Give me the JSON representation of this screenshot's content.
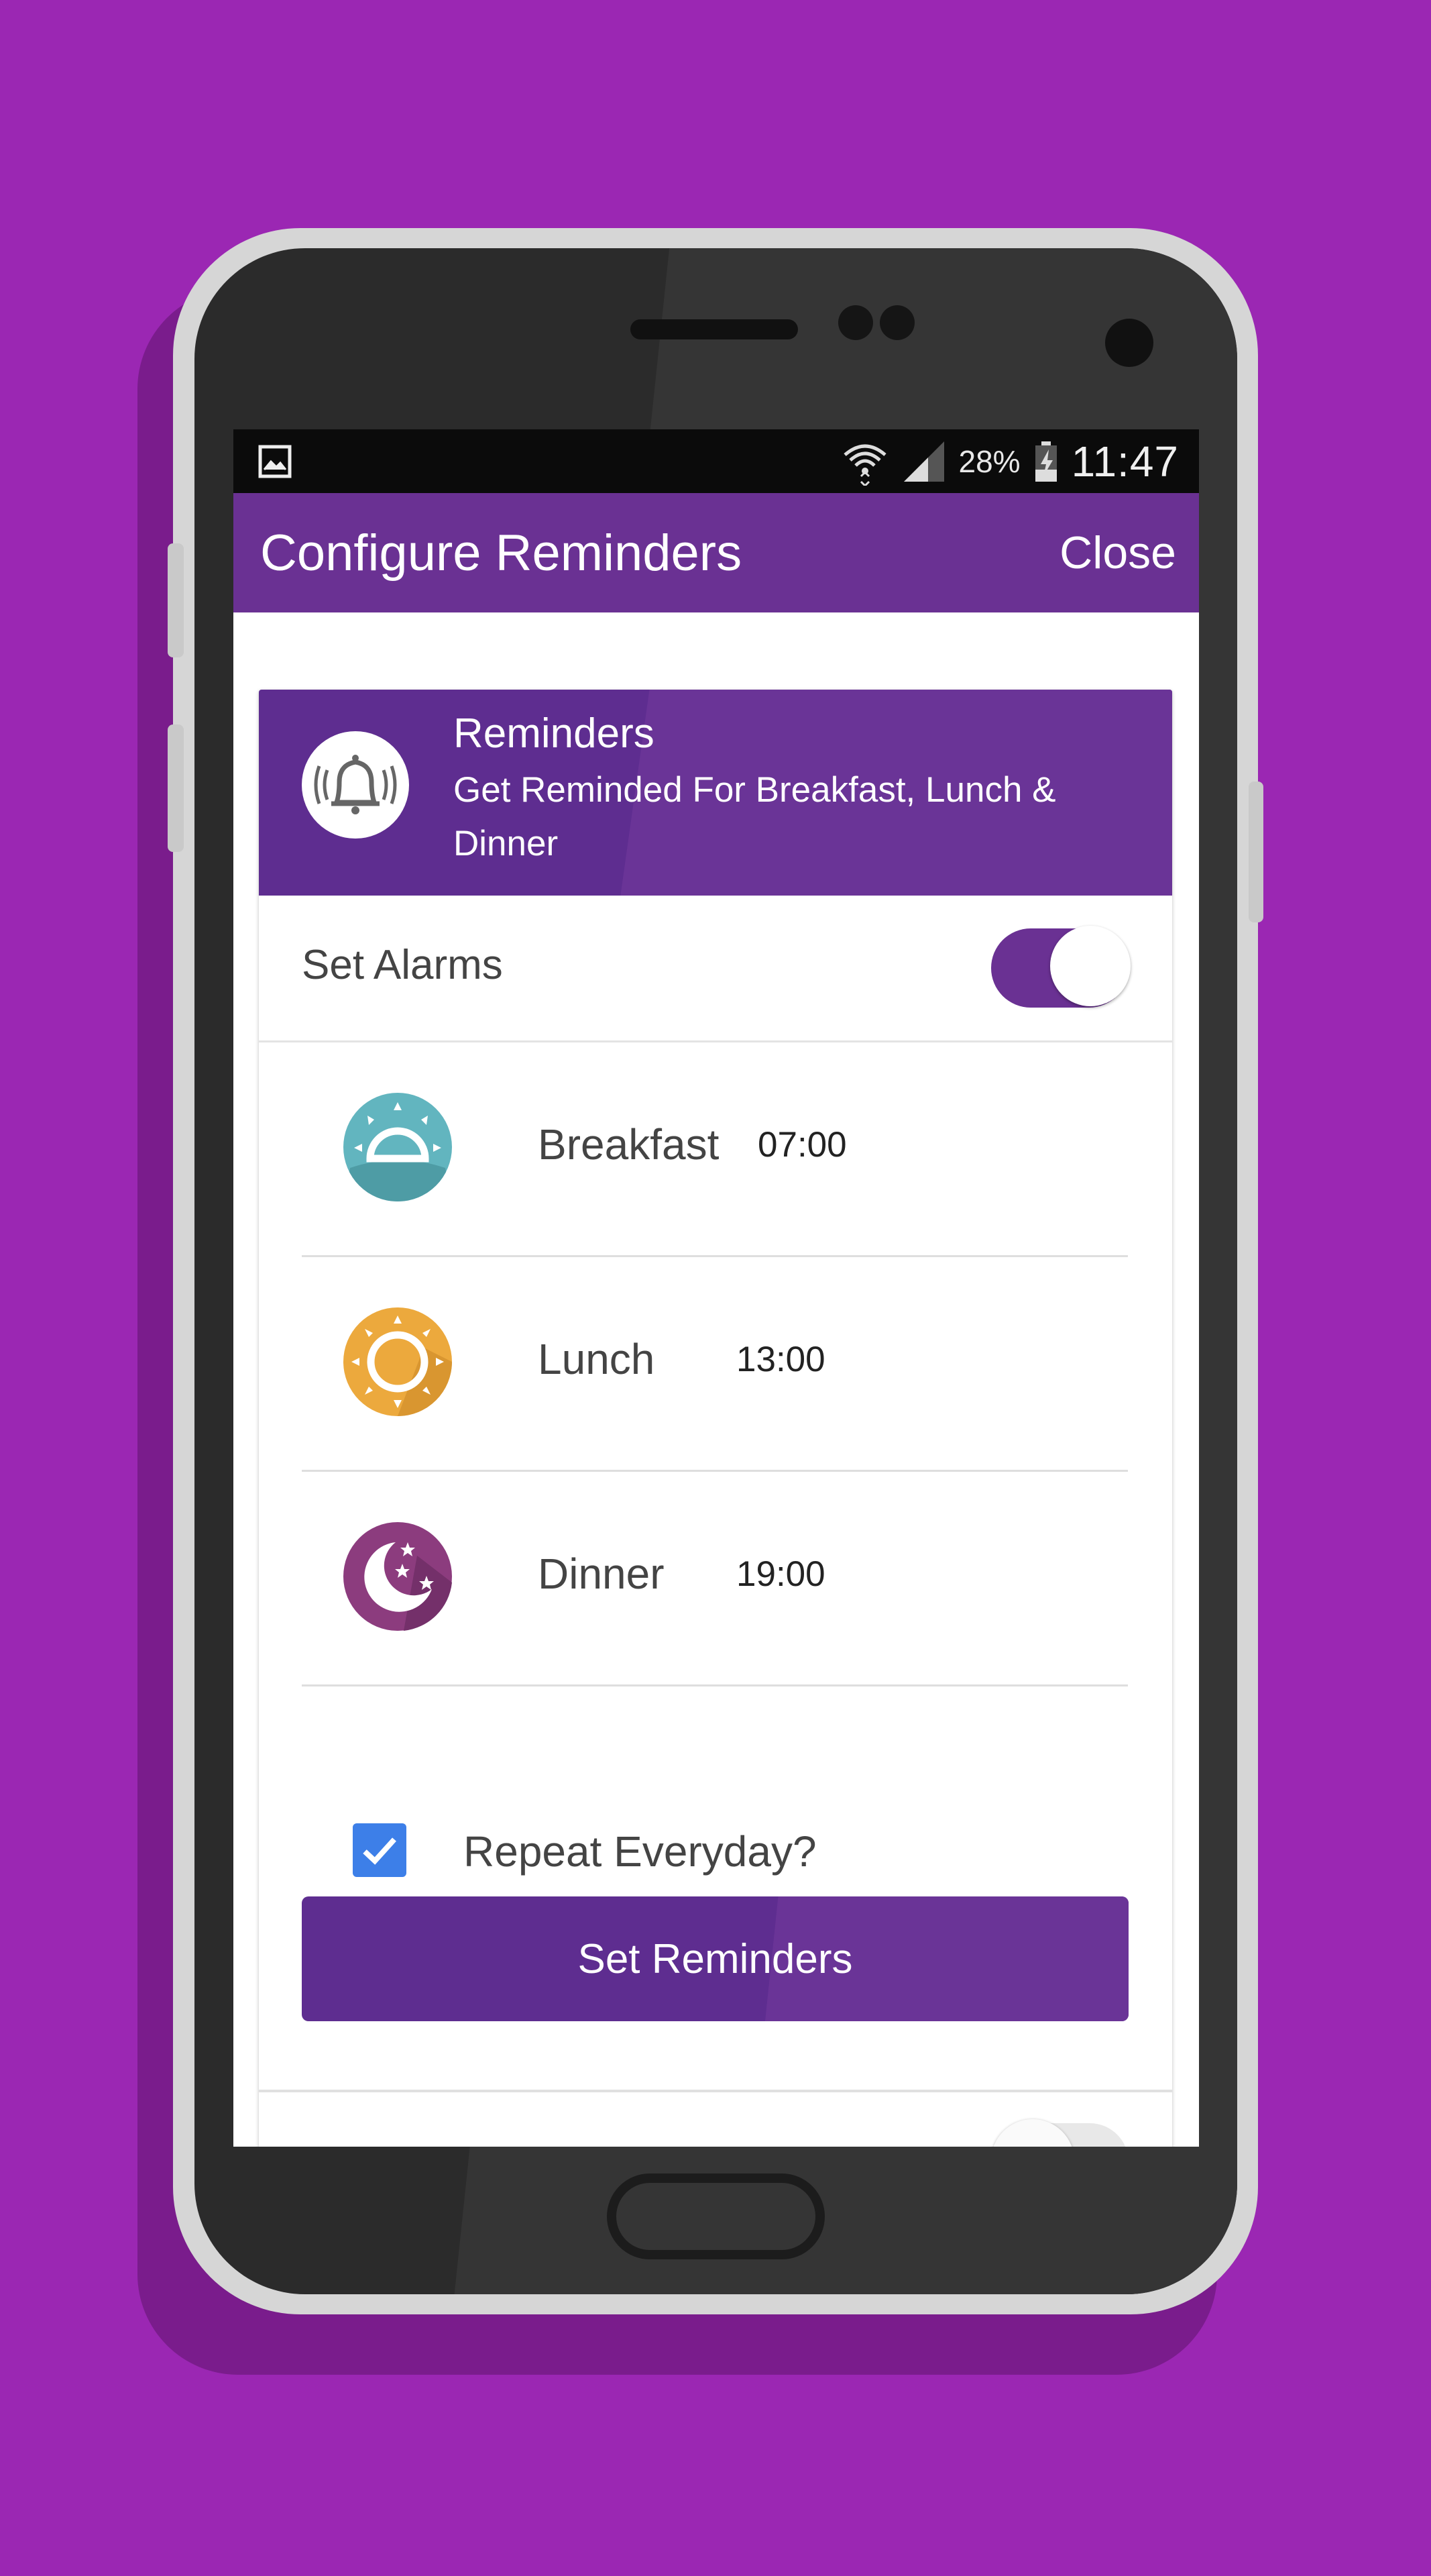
{
  "status_bar": {
    "battery_percent": "28%",
    "time": "11:47"
  },
  "app_bar": {
    "title": "Configure Reminders",
    "close_label": "Close"
  },
  "reminders_card": {
    "title": "Reminders",
    "subtitle": "Get Reminded For Breakfast, Lunch & Dinner"
  },
  "alarms": {
    "label": "Set Alarms",
    "enabled": true
  },
  "meals": [
    {
      "name": "Breakfast",
      "time": "07:00",
      "icon": "sunrise-icon",
      "color": "#5fb4bd"
    },
    {
      "name": "Lunch",
      "time": "13:00",
      "icon": "sun-icon",
      "color": "#eba83c"
    },
    {
      "name": "Dinner",
      "time": "19:00",
      "icon": "moon-icon",
      "color": "#8a3a7c"
    }
  ],
  "repeat": {
    "label": "Repeat Everyday?",
    "checked": true
  },
  "set_button": {
    "label": "Set Reminders"
  },
  "colors": {
    "background": "#9b27b3",
    "primary": "#6a3193",
    "checkbox": "#3d7fe8"
  }
}
